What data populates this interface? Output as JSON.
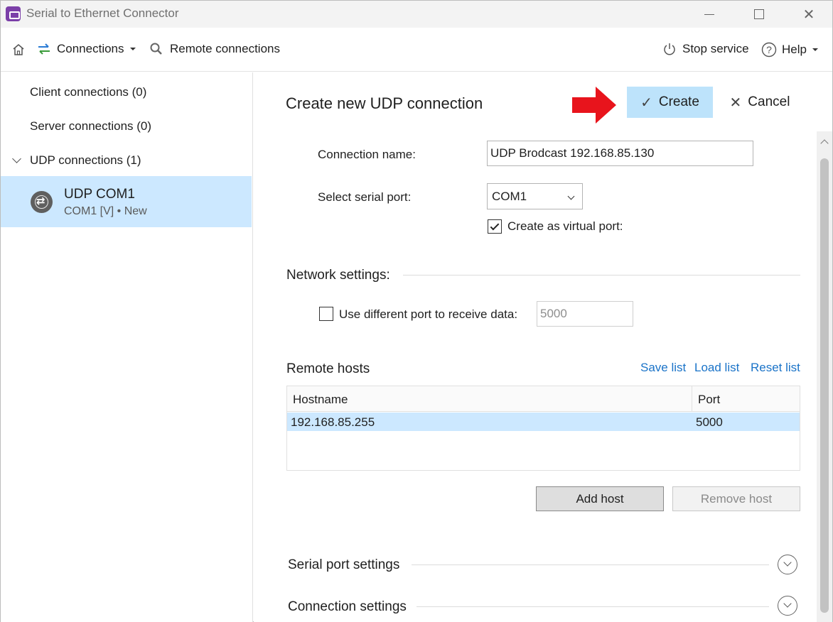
{
  "window": {
    "title": "Serial to Ethernet Connector"
  },
  "toolbar": {
    "connections_label": "Connections",
    "remote_connections_label": "Remote connections",
    "stop_service_label": "Stop service",
    "help_label": "Help"
  },
  "sidebar": {
    "client_connections": "Client connections (0)",
    "server_connections": "Server connections (0)",
    "udp_connections": "UDP connections (1)",
    "selected_item": {
      "title": "UDP COM1",
      "subtitle": "COM1 [V] • New"
    }
  },
  "form": {
    "title": "Create new UDP connection",
    "create_label": "Create",
    "cancel_label": "Cancel",
    "connection_name_label": "Connection name:",
    "connection_name_value": "UDP Brodcast 192.168.85.130",
    "serial_port_label": "Select serial port:",
    "serial_port_value": "COM1",
    "virtual_port_label": "Create as virtual port:",
    "virtual_port_checked": true
  },
  "network": {
    "section_title": "Network settings:",
    "diff_port_label": "Use different port to receive data:",
    "diff_port_checked": false,
    "diff_port_value": "5000"
  },
  "remote_hosts": {
    "section_title": "Remote hosts",
    "save_list": "Save list",
    "load_list": "Load list",
    "reset_list": "Reset list",
    "columns": [
      "Hostname",
      "Port"
    ],
    "rows": [
      {
        "hostname": "192.168.85.255",
        "port": "5000"
      }
    ],
    "add_host": "Add host",
    "remove_host": "Remove host"
  },
  "sections": {
    "serial_port_settings": "Serial port settings",
    "connection_settings": "Connection settings"
  },
  "colors": {
    "selection": "#cce8ff",
    "create_button": "#bde3fb",
    "link": "#1a73c8",
    "annotation_arrow": "#e8141c"
  },
  "icons": [
    "app-icon",
    "home-icon",
    "connections-icon",
    "search-icon",
    "power-icon",
    "help-icon",
    "globe-icon",
    "check-icon",
    "close-icon",
    "chevron-down-icon"
  ]
}
